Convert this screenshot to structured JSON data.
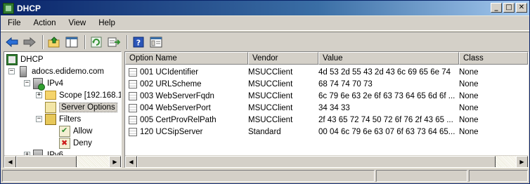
{
  "window": {
    "title": "DHCP",
    "controls": {
      "minimize": "_",
      "maximize": "□",
      "close": "✕"
    }
  },
  "menu": [
    "File",
    "Action",
    "View",
    "Help"
  ],
  "toolbar": {
    "buttons": [
      "back-arrow",
      "forward-arrow",
      "up-folder",
      "show-hide-console-tree",
      "refresh",
      "export-list",
      "help",
      "properties"
    ]
  },
  "tree": {
    "root": "DHCP",
    "server": "adocs.edidemo.com",
    "ipv4": "IPv4",
    "scope": "Scope [192.168.1",
    "server_options": "Server Options",
    "filters": "Filters",
    "allow": "Allow",
    "deny": "Deny",
    "ipv6": "IPv6"
  },
  "list": {
    "columns": [
      "Option Name",
      "Vendor",
      "Value",
      "Class"
    ],
    "rows": [
      {
        "name": "001 UCIdentifier",
        "vendor": "MSUCClient",
        "value": "4d 53 2d 55 43 2d 43 6c 69 65 6e 74",
        "class": "None"
      },
      {
        "name": "002 URLScheme",
        "vendor": "MSUCClient",
        "value": "68 74 74 70 73",
        "class": "None"
      },
      {
        "name": "003 WebServerFqdn",
        "vendor": "MSUCClient",
        "value": "6c 79 6e 63 2e 6f 63 73 64 65 6d 6f ...",
        "class": "None"
      },
      {
        "name": "004 WebServerPort",
        "vendor": "MSUCClient",
        "value": "34 34 33",
        "class": "None"
      },
      {
        "name": "005 CertProvRelPath",
        "vendor": "MSUCClient",
        "value": "2f 43 65 72 74 50 72 6f 76 2f 43 65 ...",
        "class": "None"
      },
      {
        "name": "120 UCSipServer",
        "vendor": "Standard",
        "value": "00 04 6c 79 6e 63 07 6f 63 73 64 65...",
        "class": "None"
      }
    ]
  },
  "colors": {
    "title_start": "#0a246a",
    "title_end": "#a6caf0",
    "face": "#d4d0c8"
  }
}
